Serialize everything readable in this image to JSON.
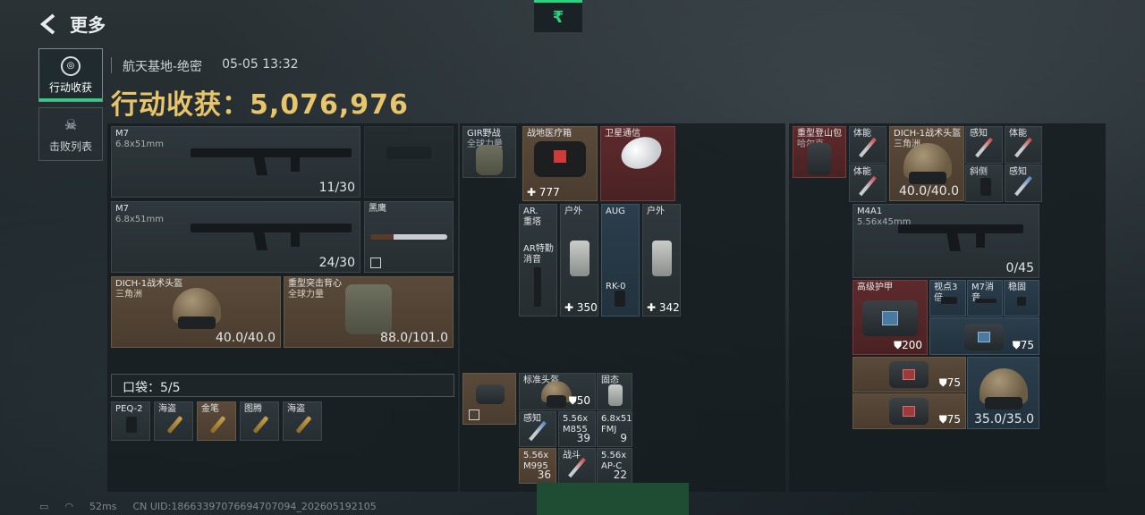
{
  "header": {
    "back_label": "更多",
    "top_tab_icon": "₹"
  },
  "side_tabs": [
    {
      "label": "行动收获",
      "icon": "target-icon",
      "active": true
    },
    {
      "label": "击败列表",
      "icon": "skull-icon",
      "active": false
    }
  ],
  "meta": {
    "map": "航天基地-绝密",
    "time": "05-05 13:32"
  },
  "haul": {
    "label": "行动收获：",
    "value": "5,076,976"
  },
  "loadout": {
    "weapon1": {
      "name": "M7",
      "caliber": "6.8x51mm",
      "ammo": "11/30"
    },
    "weapon2": {
      "name": "M7",
      "caliber": "6.8x51mm",
      "ammo": "24/30"
    },
    "melee": {
      "name": "黑鹰"
    },
    "helmet": {
      "name": "DICH-1战术头盔",
      "sub": "三角洲",
      "durability": "40.0/40.0"
    },
    "armor": {
      "name": "重型突击背心",
      "sub": "全球力量",
      "durability": "88.0/101.0"
    },
    "pocket_label": "口袋：5/5",
    "pocket_items": [
      "PEQ-2",
      "海盗",
      "金笔",
      "图腾",
      "海盗"
    ]
  },
  "middle": {
    "rig": {
      "name": "GIR野战",
      "sub": "全球力量"
    },
    "medkit": {
      "name": "战地医疗箱",
      "value": "777"
    },
    "satcom": {
      "name": "卫星通信"
    },
    "items": [
      {
        "name": "AR.\n重塔",
        "sub": ""
      },
      {
        "name": "户外",
        "sub": ""
      },
      {
        "name": "AUG",
        "sub": ""
      },
      {
        "name": "户外",
        "sub": ""
      },
      {
        "name": "AR特勤\n消音",
        "sub": ""
      },
      {
        "name": "RK-0",
        "sub": ""
      }
    ],
    "case1_value": "350",
    "case2_value": "342",
    "container": {
      "std_helmet": {
        "name": "标准头盔",
        "value": "50"
      },
      "solid": {
        "name": "固态"
      },
      "sensor": {
        "name": "感知"
      },
      "ammo1": {
        "name": "5.56x\nM855",
        "count": "39"
      },
      "ammo2": {
        "name": "6.8x51\nFMJ",
        "count": "9"
      },
      "ammo3": {
        "name": "5.56x\nM995",
        "count": "36"
      },
      "combat": {
        "name": "战斗"
      },
      "ammo4": {
        "name": "5.56x\nAP-C",
        "count": "22"
      }
    }
  },
  "right": {
    "backpack": {
      "name": "重型登山包",
      "sub": "哈尔克"
    },
    "helmet": {
      "name": "DICH-1战术头盔",
      "sub": "三角洲",
      "durability": "40.0/40.0"
    },
    "small_items": [
      "体能",
      "体能",
      "感知",
      "斜侧",
      "体能",
      "感知"
    ],
    "rifle": {
      "name": "M4A1",
      "caliber": "5.56x45mm",
      "ammo": "0/45"
    },
    "armor": {
      "name": "高级护甲",
      "value": "200"
    },
    "attachments": [
      "视点3倍",
      "M7消音",
      "稳固"
    ],
    "bag_values": [
      "75",
      "75",
      "75"
    ],
    "helmet2": {
      "durability": "35.0/35.0"
    }
  },
  "status": {
    "ping": "52ms",
    "uid": "CN UID:18663397076694707094_202605192105"
  },
  "colors": {
    "accent": "#2bd17e",
    "haul": "#e8c46a"
  }
}
